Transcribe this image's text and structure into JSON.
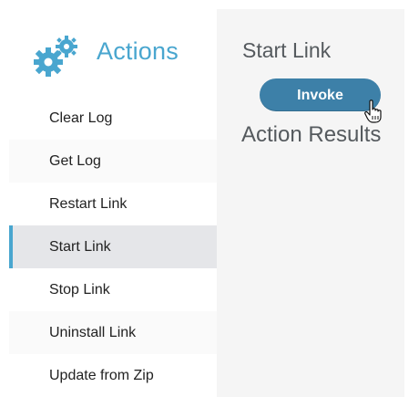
{
  "sidebar": {
    "icon": "gears-icon",
    "title": "Actions",
    "items": [
      {
        "label": "Clear Log"
      },
      {
        "label": "Get Log"
      },
      {
        "label": "Restart Link"
      },
      {
        "label": "Start Link"
      },
      {
        "label": "Stop Link"
      },
      {
        "label": "Uninstall Link"
      },
      {
        "label": "Update from Zip"
      }
    ],
    "active_item": "Start Link"
  },
  "main": {
    "title": "Start Link",
    "invoke_label": "Invoke",
    "results_title": "Action Results",
    "cursor": "hand-pointer-icon"
  },
  "colors": {
    "accent": "#49a6cf",
    "button": "#3d80a8",
    "active_bg": "#e5e6e9",
    "content_bg": "#f5f5f5"
  }
}
